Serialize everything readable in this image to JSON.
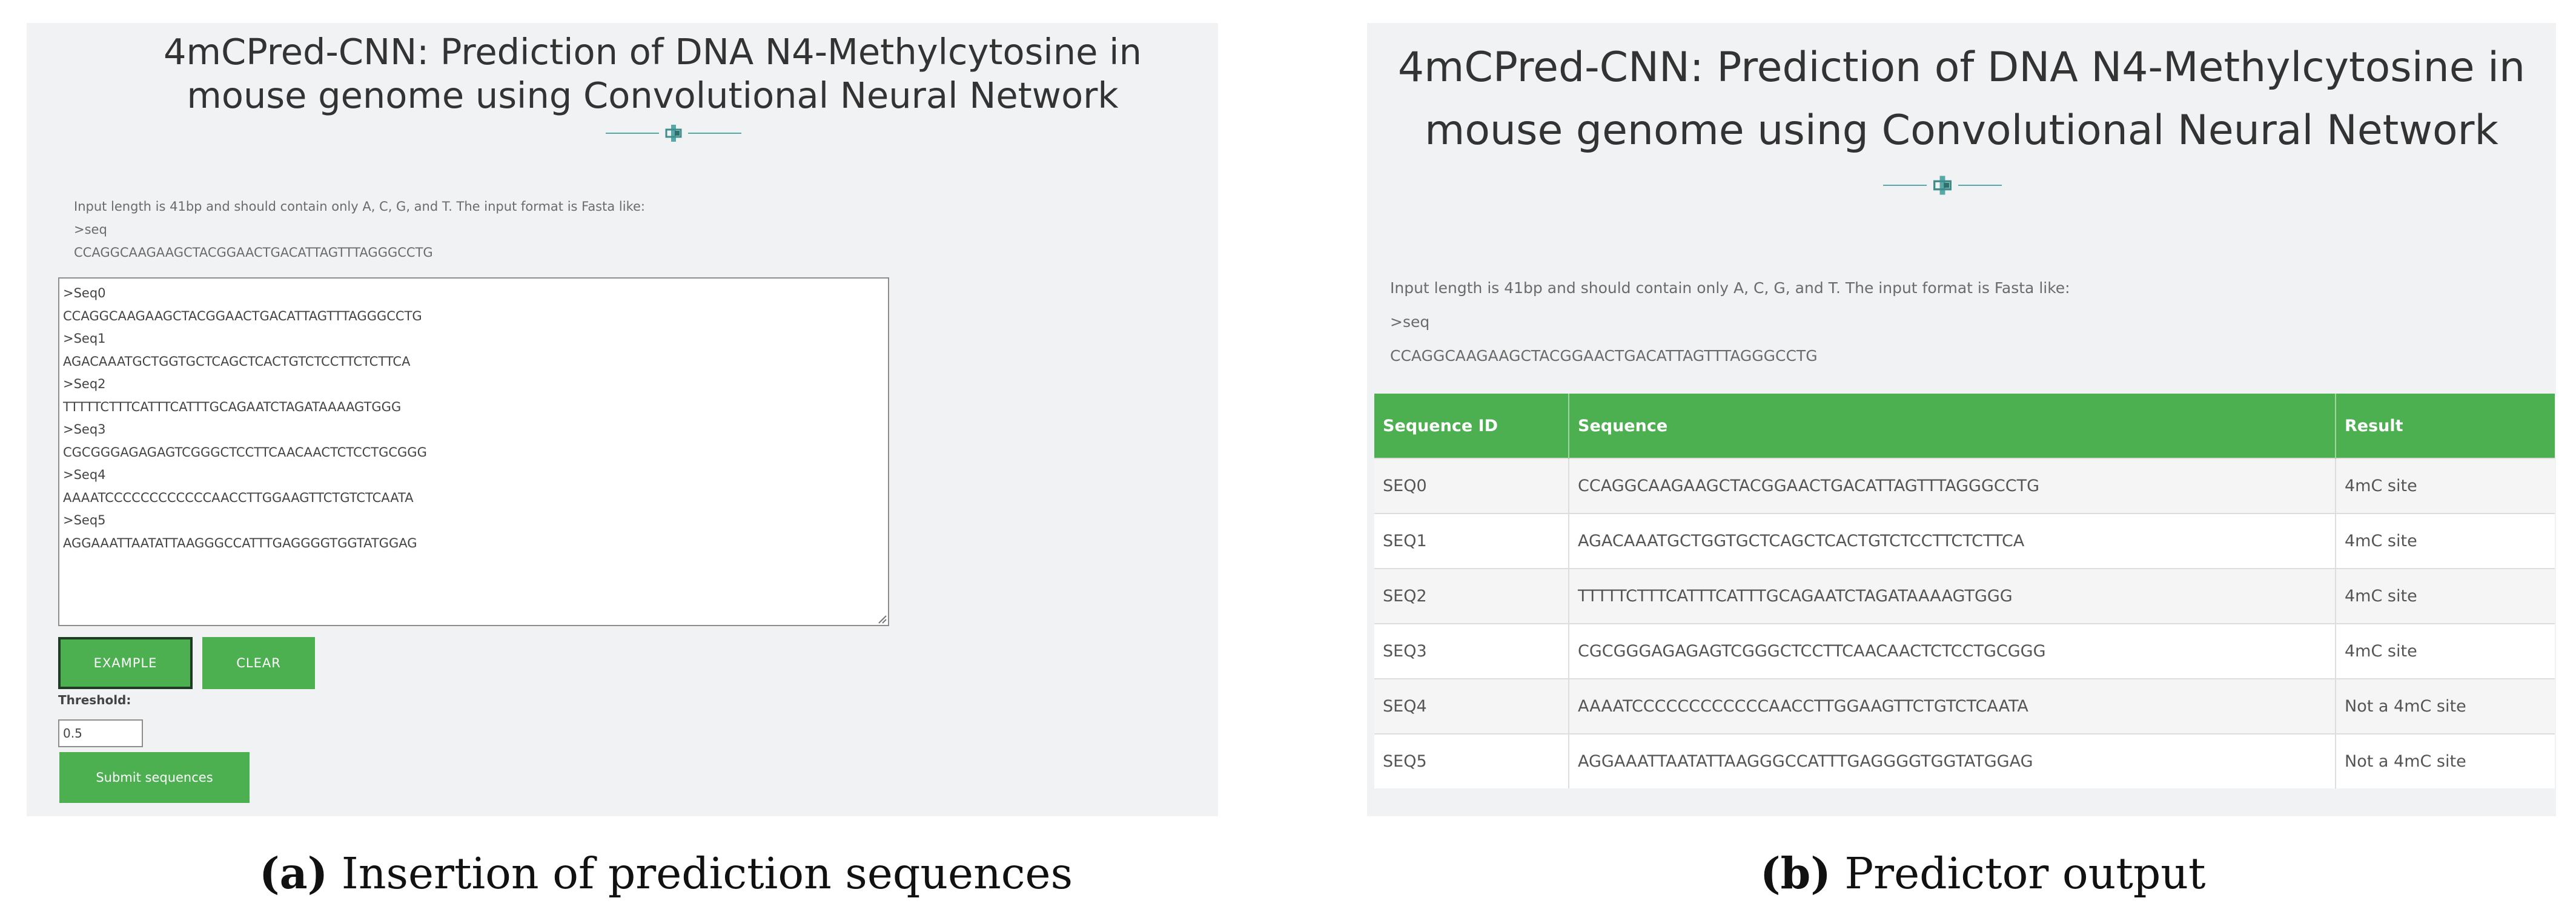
{
  "colors": {
    "accent": "#4caf50",
    "panel_bg": "#f1f2f3",
    "divider": "#56a9a6"
  },
  "panel_a": {
    "title_line1": "4mCPred-CNN: Prediction of DNA N4-Methylcytosine in",
    "title_line2": "mouse genome using Convolutional Neural Network",
    "info": {
      "line1": "Input length is 41bp and should contain only A, C, G, and T. The input format is Fasta like:",
      "line2": ">seq",
      "line3": "CCAGGCAAGAAGCTACGGAACTGACATTAGTTTAGGGCCTG"
    },
    "textarea_value": ">Seq0\nCCAGGCAAGAAGCTACGGAACTGACATTAGTTTAGGGCCTG\n>Seq1\nAGACAAATGCTGGTGCTCAGCTCACTGTCTCCTTCTCTTCA\n>Seq2\nTTTTTCTTTCATTTCATTTGCAGAATCTAGATAAAAGTGGG\n>Seq3\nCGCGGGAGAGAGTCGGGCTCCTTCAACAACTCTCCTGCGGG\n>Seq4\nAAAATCCCCCCCCCCCCAACCTTGGAAGTTCTGTCTCAATA\n>Seq5\nAGGAAATTAATATTAAGGGCCATTTGAGGGGTGGTATGGAG",
    "example_button": "EXAMPLE",
    "clear_button": "CLEAR",
    "threshold_label": "Threshold:",
    "threshold_value": "0.5",
    "submit_button": "Submit sequences"
  },
  "panel_b": {
    "title_line1": "4mCPred-CNN: Prediction of DNA N4-Methylcytosine in",
    "title_line2": "mouse genome using Convolutional Neural Network",
    "info": {
      "line1": "Input length is 41bp and should contain only A, C, G, and T. The input format is Fasta like:",
      "line2": ">seq",
      "line3": "CCAGGCAAGAAGCTACGGAACTGACATTAGTTTAGGGCCTG"
    },
    "table": {
      "headers": [
        "Sequence ID",
        "Sequence",
        "Result"
      ],
      "rows": [
        {
          "id": "SEQ0",
          "sequence": "CCAGGCAAGAAGCTACGGAACTGACATTAGTTTAGGGCCTG",
          "result": "4mC site"
        },
        {
          "id": "SEQ1",
          "sequence": "AGACAAATGCTGGTGCTCAGCTCACTGTCTCCTTCTCTTCA",
          "result": "4mC site"
        },
        {
          "id": "SEQ2",
          "sequence": "TTTTTCTTTCATTTCATTTGCAGAATCTAGATAAAAGTGGG",
          "result": "4mC site"
        },
        {
          "id": "SEQ3",
          "sequence": "CGCGGGAGAGAGTCGGGCTCCTTCAACAACTCTCCTGCGGG",
          "result": "4mC site"
        },
        {
          "id": "SEQ4",
          "sequence": "AAAATCCCCCCCCCCCCAACCTTGGAAGTTCTGTCTCAATA",
          "result": "Not a 4mC site"
        },
        {
          "id": "SEQ5",
          "sequence": "AGGAAATTAATATTAAGGGCCATTTGAGGGGTGGTATGGAG",
          "result": "Not a 4mC site"
        }
      ]
    }
  },
  "captions": {
    "a_tag": "(a)",
    "a_text": " Insertion of prediction sequences",
    "b_tag": "(b)",
    "b_text": " Predictor output"
  }
}
